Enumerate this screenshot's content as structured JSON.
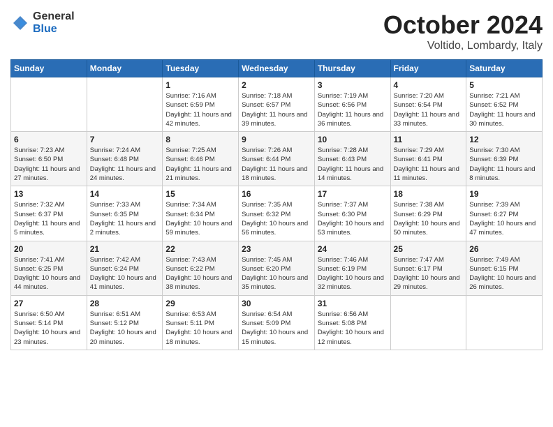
{
  "logo": {
    "general": "General",
    "blue": "Blue"
  },
  "title": "October 2024",
  "subtitle": "Voltido, Lombardy, Italy",
  "days_of_week": [
    "Sunday",
    "Monday",
    "Tuesday",
    "Wednesday",
    "Thursday",
    "Friday",
    "Saturday"
  ],
  "weeks": [
    [
      {
        "day": "",
        "detail": ""
      },
      {
        "day": "",
        "detail": ""
      },
      {
        "day": "1",
        "detail": "Sunrise: 7:16 AM\nSunset: 6:59 PM\nDaylight: 11 hours and 42 minutes."
      },
      {
        "day": "2",
        "detail": "Sunrise: 7:18 AM\nSunset: 6:57 PM\nDaylight: 11 hours and 39 minutes."
      },
      {
        "day": "3",
        "detail": "Sunrise: 7:19 AM\nSunset: 6:56 PM\nDaylight: 11 hours and 36 minutes."
      },
      {
        "day": "4",
        "detail": "Sunrise: 7:20 AM\nSunset: 6:54 PM\nDaylight: 11 hours and 33 minutes."
      },
      {
        "day": "5",
        "detail": "Sunrise: 7:21 AM\nSunset: 6:52 PM\nDaylight: 11 hours and 30 minutes."
      }
    ],
    [
      {
        "day": "6",
        "detail": "Sunrise: 7:23 AM\nSunset: 6:50 PM\nDaylight: 11 hours and 27 minutes."
      },
      {
        "day": "7",
        "detail": "Sunrise: 7:24 AM\nSunset: 6:48 PM\nDaylight: 11 hours and 24 minutes."
      },
      {
        "day": "8",
        "detail": "Sunrise: 7:25 AM\nSunset: 6:46 PM\nDaylight: 11 hours and 21 minutes."
      },
      {
        "day": "9",
        "detail": "Sunrise: 7:26 AM\nSunset: 6:44 PM\nDaylight: 11 hours and 18 minutes."
      },
      {
        "day": "10",
        "detail": "Sunrise: 7:28 AM\nSunset: 6:43 PM\nDaylight: 11 hours and 14 minutes."
      },
      {
        "day": "11",
        "detail": "Sunrise: 7:29 AM\nSunset: 6:41 PM\nDaylight: 11 hours and 11 minutes."
      },
      {
        "day": "12",
        "detail": "Sunrise: 7:30 AM\nSunset: 6:39 PM\nDaylight: 11 hours and 8 minutes."
      }
    ],
    [
      {
        "day": "13",
        "detail": "Sunrise: 7:32 AM\nSunset: 6:37 PM\nDaylight: 11 hours and 5 minutes."
      },
      {
        "day": "14",
        "detail": "Sunrise: 7:33 AM\nSunset: 6:35 PM\nDaylight: 11 hours and 2 minutes."
      },
      {
        "day": "15",
        "detail": "Sunrise: 7:34 AM\nSunset: 6:34 PM\nDaylight: 10 hours and 59 minutes."
      },
      {
        "day": "16",
        "detail": "Sunrise: 7:35 AM\nSunset: 6:32 PM\nDaylight: 10 hours and 56 minutes."
      },
      {
        "day": "17",
        "detail": "Sunrise: 7:37 AM\nSunset: 6:30 PM\nDaylight: 10 hours and 53 minutes."
      },
      {
        "day": "18",
        "detail": "Sunrise: 7:38 AM\nSunset: 6:29 PM\nDaylight: 10 hours and 50 minutes."
      },
      {
        "day": "19",
        "detail": "Sunrise: 7:39 AM\nSunset: 6:27 PM\nDaylight: 10 hours and 47 minutes."
      }
    ],
    [
      {
        "day": "20",
        "detail": "Sunrise: 7:41 AM\nSunset: 6:25 PM\nDaylight: 10 hours and 44 minutes."
      },
      {
        "day": "21",
        "detail": "Sunrise: 7:42 AM\nSunset: 6:24 PM\nDaylight: 10 hours and 41 minutes."
      },
      {
        "day": "22",
        "detail": "Sunrise: 7:43 AM\nSunset: 6:22 PM\nDaylight: 10 hours and 38 minutes."
      },
      {
        "day": "23",
        "detail": "Sunrise: 7:45 AM\nSunset: 6:20 PM\nDaylight: 10 hours and 35 minutes."
      },
      {
        "day": "24",
        "detail": "Sunrise: 7:46 AM\nSunset: 6:19 PM\nDaylight: 10 hours and 32 minutes."
      },
      {
        "day": "25",
        "detail": "Sunrise: 7:47 AM\nSunset: 6:17 PM\nDaylight: 10 hours and 29 minutes."
      },
      {
        "day": "26",
        "detail": "Sunrise: 7:49 AM\nSunset: 6:15 PM\nDaylight: 10 hours and 26 minutes."
      }
    ],
    [
      {
        "day": "27",
        "detail": "Sunrise: 6:50 AM\nSunset: 5:14 PM\nDaylight: 10 hours and 23 minutes."
      },
      {
        "day": "28",
        "detail": "Sunrise: 6:51 AM\nSunset: 5:12 PM\nDaylight: 10 hours and 20 minutes."
      },
      {
        "day": "29",
        "detail": "Sunrise: 6:53 AM\nSunset: 5:11 PM\nDaylight: 10 hours and 18 minutes."
      },
      {
        "day": "30",
        "detail": "Sunrise: 6:54 AM\nSunset: 5:09 PM\nDaylight: 10 hours and 15 minutes."
      },
      {
        "day": "31",
        "detail": "Sunrise: 6:56 AM\nSunset: 5:08 PM\nDaylight: 10 hours and 12 minutes."
      },
      {
        "day": "",
        "detail": ""
      },
      {
        "day": "",
        "detail": ""
      }
    ]
  ]
}
